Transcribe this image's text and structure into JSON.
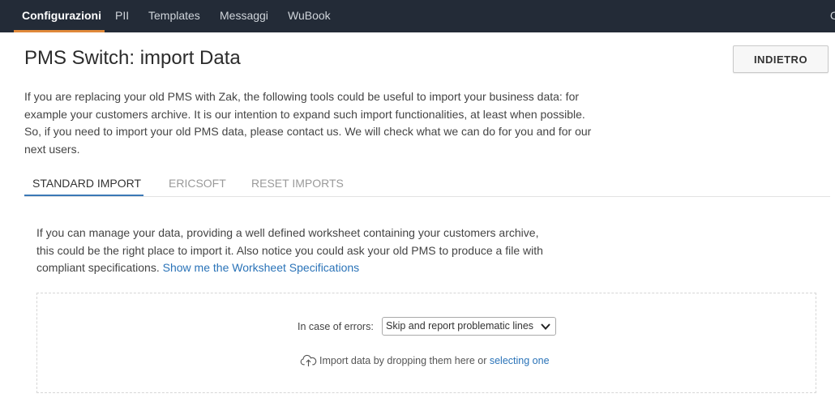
{
  "nav": {
    "items": [
      "Configurazioni",
      "PII",
      "Templates",
      "Messaggi",
      "WuBook"
    ],
    "cut_off": "C"
  },
  "header": {
    "title": "PMS Switch: import Data",
    "back_label": "INDIETRO"
  },
  "intro": {
    "text": "If you are replacing your old PMS with Zak, the following tools could be useful to import your business data: for example your customers archive. It is our intention to expand such import functionalities, at least when possible. So, if you need to import your old PMS data, please contact us. We will check what we can do for you and for our next users."
  },
  "tabs": [
    "STANDARD IMPORT",
    "ERICSOFT",
    "RESET IMPORTS"
  ],
  "standard_import": {
    "description": "If you can manage your data, providing a well defined worksheet containing your customers archive, this could be the right place to import it. Also notice you could ask your old PMS to produce a file with compliant specifications.",
    "spec_link": "Show me the Worksheet Specifications",
    "errors_label": "In case of errors:",
    "errors_selected": "Skip and report problematic lines",
    "drop_text": "Import data by dropping them here or",
    "select_link": "selecting one"
  },
  "colors": {
    "nav_bg": "#232b37",
    "nav_active_underline": "#e0893a",
    "link": "#2a73b8",
    "tab_active_underline": "#3b78b6"
  }
}
